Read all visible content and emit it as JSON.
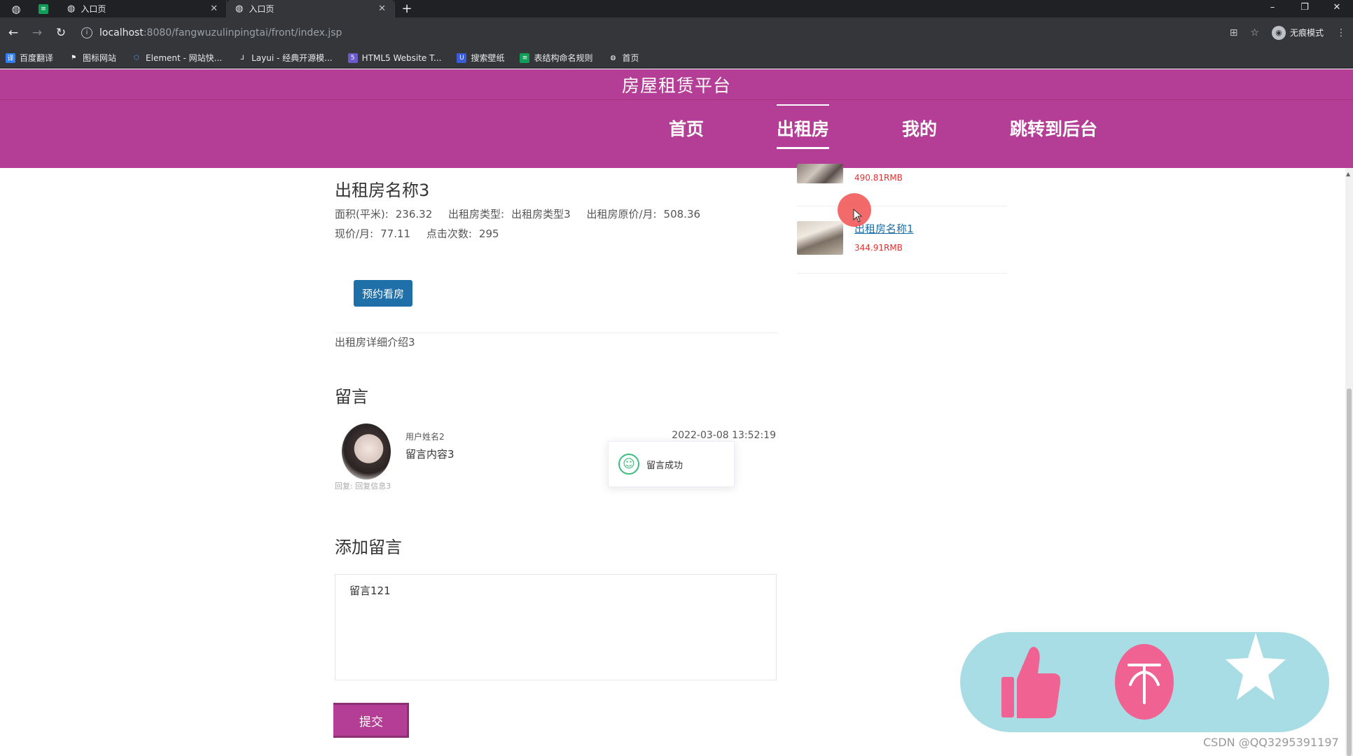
{
  "browser": {
    "tabs": [
      {
        "label": "入口页",
        "active": false
      },
      {
        "label": "入口页",
        "active": true
      }
    ],
    "url_host": "localhost",
    "url_rest": ":8080/fangwuzulinpingtai/front/index.jsp",
    "incognito_label": "无痕模式",
    "bookmarks": [
      {
        "label": "百度翻译",
        "icon": "baidu-translate-icon",
        "color": "#2f7ef6"
      },
      {
        "label": "图标网站",
        "icon": "flag-icon",
        "color": "#35363a"
      },
      {
        "label": "Element - 网站快...",
        "icon": "element-icon",
        "color": "#409eff"
      },
      {
        "label": "Layui - 经典开源模...",
        "icon": "layui-icon",
        "color": "#35363a"
      },
      {
        "label": "HTML5 Website T...",
        "icon": "html5-icon",
        "color": "#6a5acd"
      },
      {
        "label": "搜索壁纸",
        "icon": "wallpaper-icon",
        "color": "#3b5bdb"
      },
      {
        "label": "表结构命名规则",
        "icon": "sheet-icon",
        "color": "#0f9d58"
      },
      {
        "label": "首页",
        "icon": "globe-icon",
        "color": "#35363a"
      }
    ]
  },
  "site": {
    "title": "房屋租赁平台",
    "nav": [
      {
        "label": "首页",
        "active": false
      },
      {
        "label": "出租房",
        "active": true
      },
      {
        "label": "我的",
        "active": false
      },
      {
        "label": "跳转到后台",
        "active": false
      }
    ],
    "brand_color": "#b43e95"
  },
  "house": {
    "name": "出租房名称3",
    "area_label": "面积(平米):",
    "area": "236.32",
    "type_label": "出租房类型:",
    "type": "出租房类型3",
    "orig_price_label": "出租房原价/月:",
    "orig_price": "508.36",
    "price_label": "现价/月:",
    "price": "77.11",
    "clicks_label": "点击次数:",
    "clicks": "295",
    "book_button": "预约看房",
    "detail": "出租房详细介绍3"
  },
  "comments": {
    "title": "留言",
    "items": [
      {
        "user": "用户姓名2",
        "content": "留言内容3",
        "time": "2022-03-08 13:52:19",
        "reply": "回复: 回复信息3"
      }
    ]
  },
  "toast": {
    "text": "留言成功"
  },
  "add_comment": {
    "title": "添加留言",
    "textarea_value": "留言121",
    "submit_label": "提交"
  },
  "sidebar": {
    "items": [
      {
        "name": "",
        "price": "490.81RMB"
      },
      {
        "name": "出租房名称1",
        "price": "344.91RMB"
      }
    ]
  },
  "floating": {
    "like_icon": "thumbs-up-icon",
    "top_icon": "back-to-top-icon",
    "star_icon": "star-icon",
    "panel_color": "#a8dde5",
    "icon_color": "#f06292"
  },
  "watermark": "CSDN @QQ3295391197"
}
